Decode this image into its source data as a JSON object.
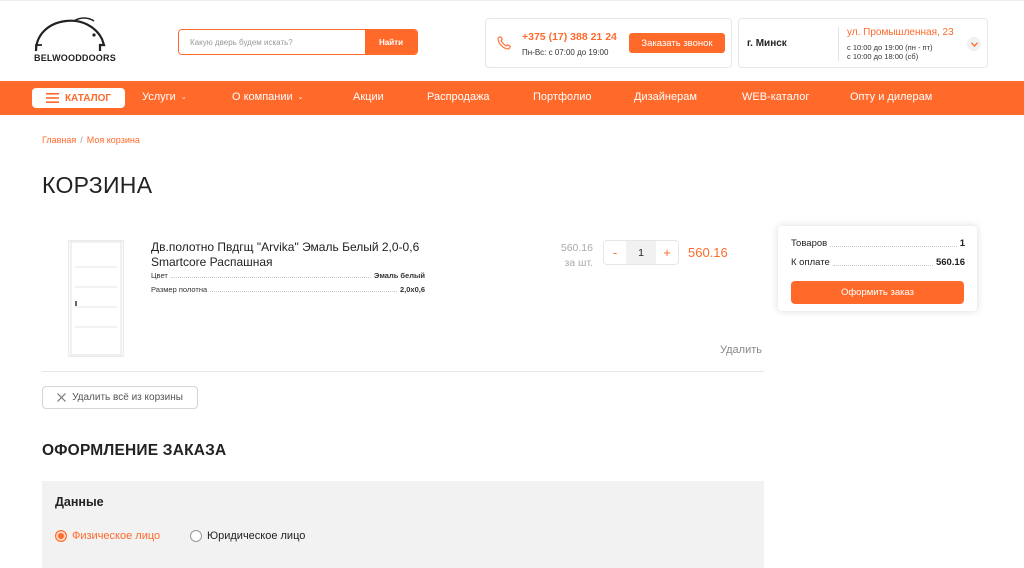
{
  "header": {
    "logo_text": "BELWOODDOORS",
    "search_placeholder": "Какую дверь будем искать?",
    "search_button": "Найти",
    "phone": "+375 (17) 388 21 24",
    "phone_hours": "Пн-Вс: с 07:00 до 19:00",
    "callback_button": "Заказать звонок",
    "city": "г. Минск",
    "address": "ул. Промышленная, 23",
    "hours_weekdays": "с 10:00 до 19:00 (пн - пт)",
    "hours_saturday": "с 10:00 до 18:00 (сб)"
  },
  "nav": {
    "catalog": "КАТАЛОГ",
    "items": [
      "Услуги",
      "О компании",
      "Акции",
      "Распродажа",
      "Портфолио",
      "Дизайнерам",
      "WEB-каталог",
      "Опту и дилерам"
    ]
  },
  "breadcrumb": [
    "Главная",
    "Моя корзина"
  ],
  "page_title": "КОРЗИНА",
  "cart": {
    "item": {
      "name": "Дв.полотно Пвдгщ \"Arvika\" Эмаль Белый 2,0-0,6 Smartcore Распашная",
      "props": [
        {
          "label": "Цвет",
          "value": "Эмаль белый"
        },
        {
          "label": "Размер полотна",
          "value": "2,0х0,6"
        }
      ],
      "unit_price": "560.16",
      "unit_label": "за шт.",
      "quantity": "1",
      "total": "560.16",
      "remove": "Удалить"
    },
    "clear_all": "Удалить всё из корзины"
  },
  "summary": {
    "items_label": "Товаров",
    "items_value": "1",
    "pay_label": "К оплате",
    "pay_value": "560.16",
    "order_button": "Оформить заказ"
  },
  "checkout": {
    "title": "ОФОРМЛЕНИЕ ЗАКАЗА",
    "section_title": "Данные",
    "options": [
      "Физическое лицо",
      "Юридическое лицо"
    ],
    "selected": "Физическое лицо"
  },
  "colors": {
    "accent": "#ff6a2b",
    "panel": "#f2f2f2"
  },
  "icons": [
    "logo-icon",
    "phone-icon",
    "chevron-down-icon",
    "menu-icon",
    "minus-icon",
    "plus-icon",
    "close-icon"
  ]
}
